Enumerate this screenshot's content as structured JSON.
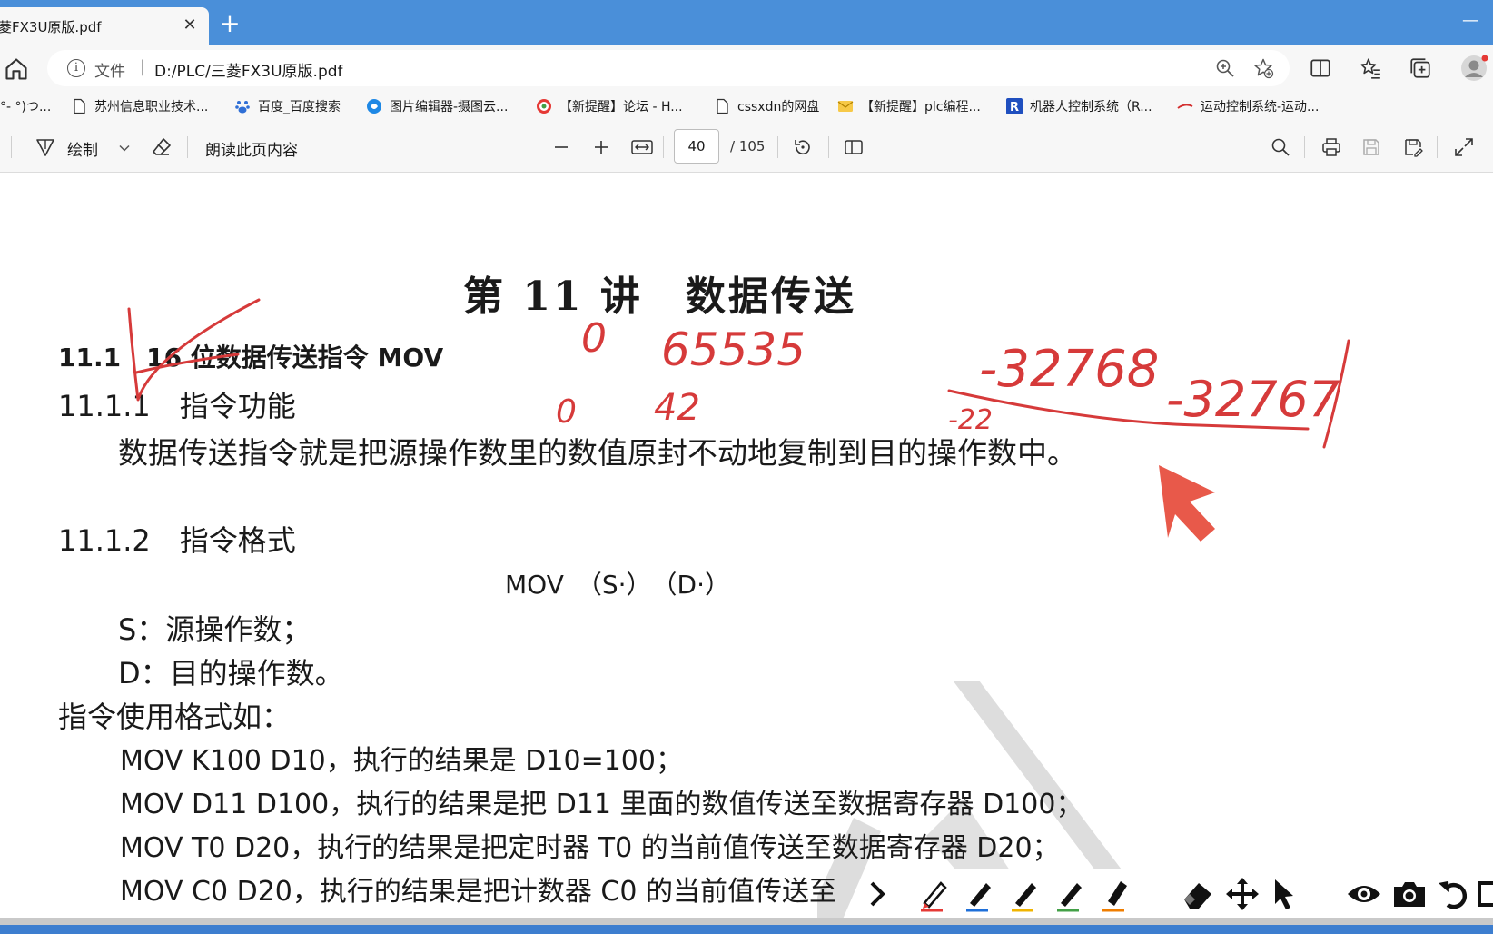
{
  "tab": {
    "title": "菱FX3U原版.pdf",
    "close": "✕",
    "new_tab": "+",
    "minimize": "—"
  },
  "address": {
    "file_label": "文件",
    "separator": "|",
    "url": "D:/PLC/三菱FX3U原版.pdf",
    "info": "i"
  },
  "bookmarks": [
    {
      "label": "°- °)つ...",
      "icon": "partial-icon"
    },
    {
      "label": "苏州信息职业技术...",
      "icon": "page-icon"
    },
    {
      "label": "百度_百度搜索",
      "icon": "baidu-icon"
    },
    {
      "label": "图片编辑器-摄图云...",
      "icon": "editor-icon"
    },
    {
      "label": "【新提醒】论坛 - H...",
      "icon": "forum-icon"
    },
    {
      "label": "cssxdn的网盘",
      "icon": "page-icon"
    },
    {
      "label": "【新提醒】plc编程...",
      "icon": "mail-icon"
    },
    {
      "label": "机器人控制系统（R...",
      "icon": "r-icon"
    },
    {
      "label": "运动控制系统-运动...",
      "icon": "brand-icon"
    }
  ],
  "pdf_toolbar": {
    "draw_label": "绘制",
    "read_aloud": "朗读此页内容",
    "page_current": "40",
    "page_total": "/ 105"
  },
  "document": {
    "title": "第 11 讲　数据传送",
    "section": "11.1　16 位数据传送指令 MOV",
    "sub1": "11.1.1　指令功能",
    "para1": "数据传送指令就是把源操作数里的数值原封不动地复制到目的操作数中。",
    "sub2": "11.1.2　指令格式",
    "format": "MOV　（S·）　（D·）",
    "s_line": "S：源操作数；",
    "d_line": "D：目的操作数。",
    "usage": "指令使用格式如：",
    "examples": [
      "MOV K100 D10，执行的结果是 D10=100；",
      "MOV D11 D100，执行的结果是把 D11 里面的数值传送至数据寄存器 D100；",
      "MOV T0 D20，执行的结果是把定时器 T0 的当前值传送至数据寄存器 D20；",
      "MOV C0 D20，执行的结果是把计数器 C0 的当前值传送至"
    ]
  },
  "handwriting": {
    "n0a": "0",
    "n65535": "65535",
    "n0b": "0",
    "n42": "42",
    "n32768": "-32768",
    "n32767": "-32767",
    "n22": "-22"
  },
  "colors": {
    "tab_strip": "#4a8fd9",
    "ink_red": "#d63a3a",
    "cursor_red": "#e8594a",
    "pen_red": "#e53935",
    "pen_blue": "#1e6fd9",
    "pen_yellow": "#f0b400",
    "pen_green": "#43a047",
    "pen_orange": "#ef7d00"
  }
}
